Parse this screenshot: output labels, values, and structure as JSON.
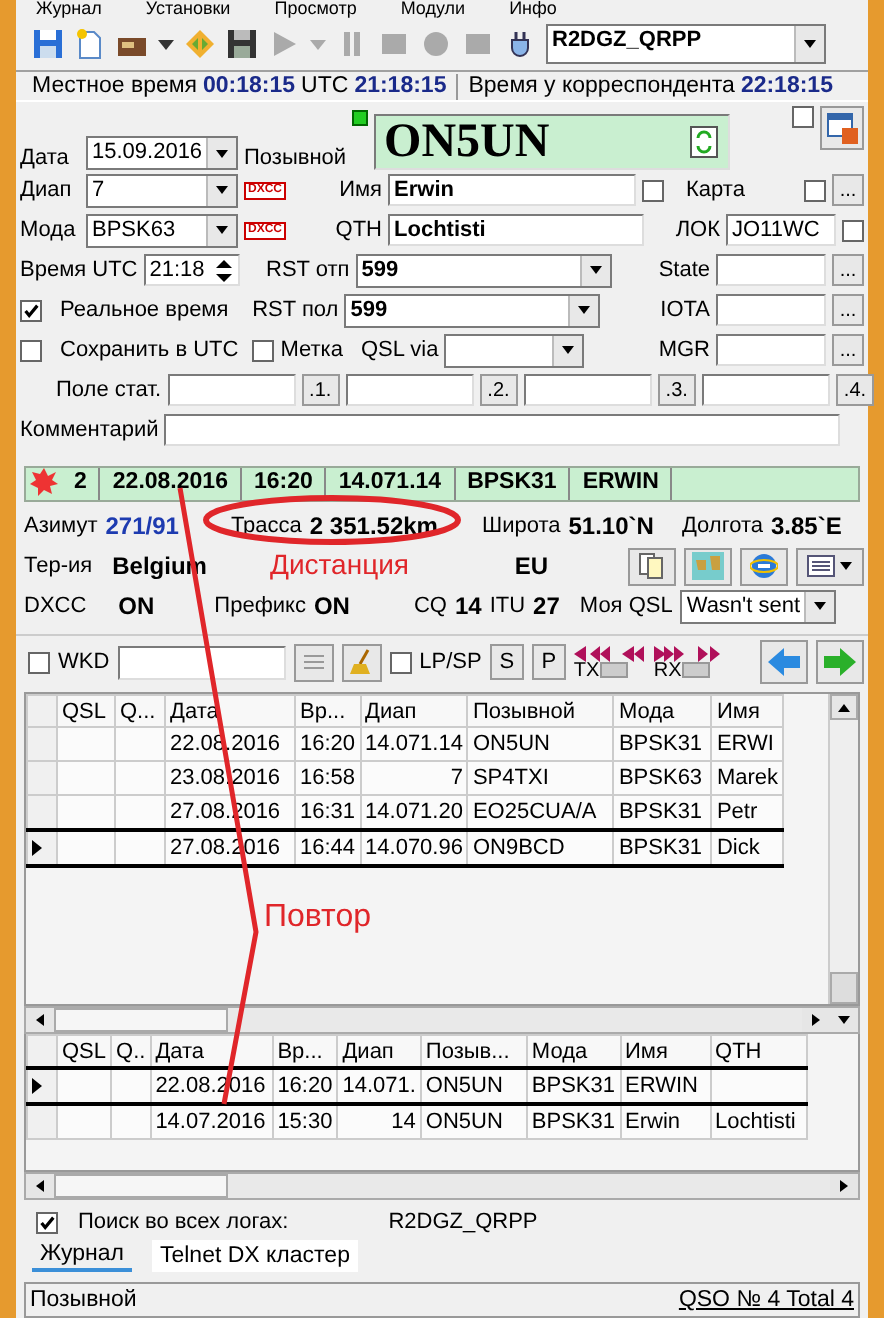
{
  "menu": [
    "Журнал",
    "Установки",
    "Просмотр",
    "Модули",
    "Инфо"
  ],
  "toolbar": {
    "log_select": "R2DGZ_QRPP"
  },
  "clock": {
    "local_label": "Местное время",
    "local": "00:18:15",
    "utc_label": "UTC",
    "utc": "21:18:15",
    "dx_label": "Время у корреспондента",
    "dx": "22:18:15"
  },
  "form": {
    "date": {
      "label": "Дата",
      "value": "15.09.2016"
    },
    "callsign": {
      "label": "Позывной",
      "value": "ON5UN"
    },
    "extra_checkbox": {
      "checked": false
    },
    "band": {
      "label": "Диап",
      "value": "7",
      "badge": "DXCC"
    },
    "name": {
      "label": "Имя",
      "value": "Erwin",
      "checked": false
    },
    "card": {
      "label": "Карта",
      "checked": false,
      "button": "..."
    },
    "mode": {
      "label": "Мода",
      "value": "BPSK63",
      "badge": "DXCC"
    },
    "qth": {
      "label": "QTH",
      "value": "Lochtisti"
    },
    "locator": {
      "label": "ЛОК",
      "value": "JO11WC",
      "checked": false
    },
    "time": {
      "label": "Время UTC",
      "value": "21:18"
    },
    "rst_sent": {
      "label": "RST отп",
      "value": "599"
    },
    "state": {
      "label": "State",
      "button": "..."
    },
    "real_time": {
      "label": "Реальное время",
      "checked": true
    },
    "rst_rcvd": {
      "label": "RST пол",
      "value": "599"
    },
    "iota": {
      "label": "IOTA",
      "button": "..."
    },
    "save_utc": {
      "label": "Сохранить в UTC",
      "checked": false
    },
    "mark": {
      "label": "Метка",
      "checked": false
    },
    "qsl_via": {
      "label": "QSL via"
    },
    "mgr": {
      "label": "MGR",
      "button": "..."
    },
    "stat_fields": {
      "label": "Поле стат.",
      "buttons": [
        ".1.",
        ".2.",
        ".3.",
        ".4."
      ]
    },
    "comment": {
      "label": "Комментарий"
    }
  },
  "previous_qso": {
    "cells": [
      "2",
      "22.08.2016",
      "16:20",
      "14.071.14",
      "BPSK31",
      "ERWIN"
    ]
  },
  "info": {
    "azimuth": {
      "label": "Азимут",
      "value": "271/91"
    },
    "distance": {
      "label": "Трасса",
      "value": "2 351.52km"
    },
    "latitude": {
      "label": "Широта",
      "value": "51.10`N"
    },
    "longitude": {
      "label": "Долгота",
      "value": "3.85`E"
    },
    "territory": {
      "label": "Тер-ия",
      "value": "Belgium"
    },
    "continent": "EU",
    "dxcc": {
      "label": "DXCC",
      "value": "ON"
    },
    "prefix": {
      "label": "Префикс",
      "value": "ON"
    },
    "cq": {
      "label": "CQ",
      "value": "14"
    },
    "itu": {
      "label": "ITU",
      "value": "27"
    },
    "my_qsl": {
      "label": "Моя QSL",
      "value": "Wasn't sent"
    }
  },
  "wkd_bar": {
    "wkd": {
      "label": "WKD",
      "checked": false
    },
    "lpsp": {
      "label": "LP/SP",
      "checked": false
    },
    "buttons": [
      "S",
      "P"
    ],
    "tx_label": "TX",
    "rx_label": "RX"
  },
  "log_grid": {
    "columns": [
      "QSL",
      "Q...",
      "Дата",
      "Вр...",
      "Диап",
      "Позывной",
      "Мода",
      "Имя"
    ],
    "rows": [
      {
        "cells": [
          "",
          "",
          "22.08.2016",
          "16:20",
          "14.071.14",
          "ON5UN",
          "BPSK31",
          "ERWI"
        ],
        "selected": false
      },
      {
        "cells": [
          "",
          "",
          "23.08.2016",
          "16:58",
          "7",
          "SP4TXI",
          "BPSK63",
          "Marek"
        ],
        "selected": false
      },
      {
        "cells": [
          "",
          "",
          "27.08.2016",
          "16:31",
          "14.071.20",
          "EO25CUA/A",
          "BPSK31",
          "Petr"
        ],
        "selected": false
      },
      {
        "cells": [
          "",
          "",
          "27.08.2016",
          "16:44",
          "14.070.96",
          "ON9BCD",
          "BPSK31",
          "Dick"
        ],
        "selected": true
      }
    ]
  },
  "dupes_grid": {
    "columns": [
      "QSL",
      "Q..",
      "Дата",
      "Вр...",
      "Диап",
      "Позыв...",
      "Мода",
      "Имя",
      "QTH"
    ],
    "rows": [
      {
        "cells": [
          "",
          "",
          "22.08.2016",
          "16:20",
          "14.071.",
          "ON5UN",
          "BPSK31",
          "ERWIN",
          ""
        ],
        "selected": true
      },
      {
        "cells": [
          "",
          "",
          "14.07.2016",
          "15:30",
          "14",
          "ON5UN",
          "BPSK31",
          "Erwin",
          "Lochtisti"
        ],
        "selected": false
      }
    ]
  },
  "search_all": {
    "label": "Поиск во всех логах:",
    "checked": true,
    "log": "R2DGZ_QRPP"
  },
  "tabs": [
    {
      "label": "Журнал",
      "selected": true
    },
    {
      "label": "Telnet DX кластер",
      "selected": false
    }
  ],
  "status_bar": {
    "field": "Позывной",
    "counter": "QSO № 4 Total 4"
  },
  "annotations": [
    {
      "text": "Дистанция"
    },
    {
      "text": "Повтор"
    }
  ]
}
